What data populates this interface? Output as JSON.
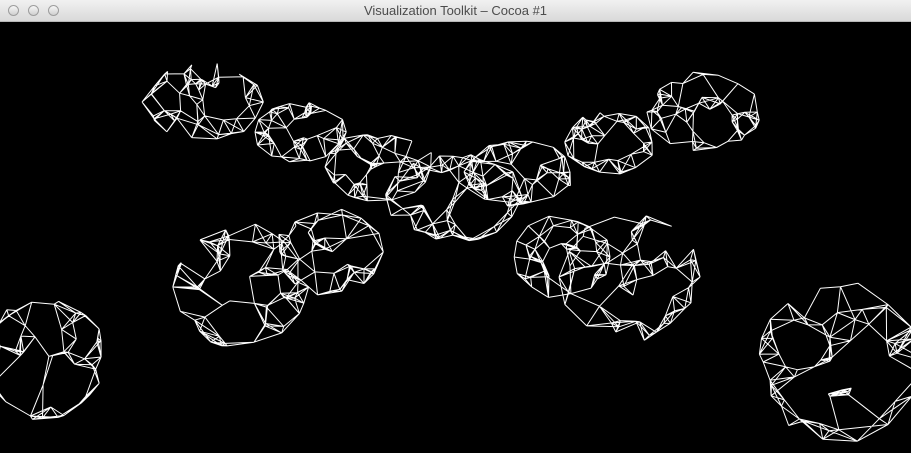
{
  "window": {
    "title": "Visualization Toolkit – Cocoa #1",
    "background_color": "#000000",
    "mesh_color": "#ffffff"
  },
  "controls": {
    "close_icon": "close-icon",
    "minimize_icon": "minimize-icon",
    "zoom_icon": "zoom-icon"
  }
}
